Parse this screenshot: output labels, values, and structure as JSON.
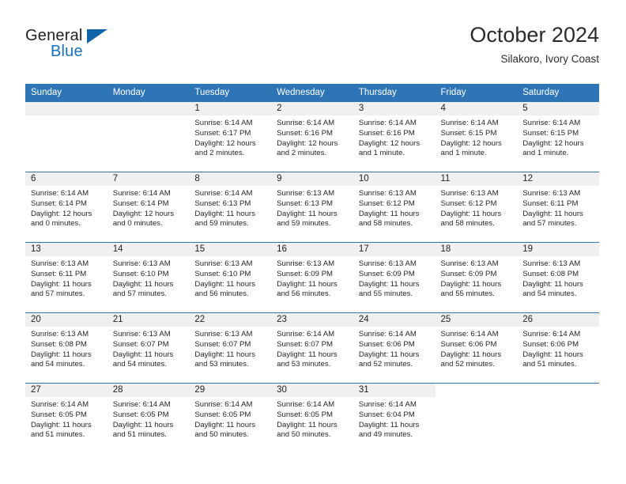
{
  "brand": {
    "word_top": "General",
    "word_bottom": "Blue",
    "triangle_color": "#1264a8",
    "blue_color": "#1673bb"
  },
  "header": {
    "title": "October 2024",
    "subtitle": "Silakoro, Ivory Coast"
  },
  "theme": {
    "header_bg": "#2e75b6",
    "daynum_bg": "#f0f0f0",
    "grid_line": "#2e75b6"
  },
  "calendar": {
    "weekday_headers": [
      "Sunday",
      "Monday",
      "Tuesday",
      "Wednesday",
      "Thursday",
      "Friday",
      "Saturday"
    ],
    "weeks": [
      [
        {
          "day": "",
          "blank": true
        },
        {
          "day": "",
          "blank": true
        },
        {
          "day": "1",
          "sunrise": "Sunrise: 6:14 AM",
          "sunset": "Sunset: 6:17 PM",
          "daylight": "Daylight: 12 hours and 2 minutes."
        },
        {
          "day": "2",
          "sunrise": "Sunrise: 6:14 AM",
          "sunset": "Sunset: 6:16 PM",
          "daylight": "Daylight: 12 hours and 2 minutes."
        },
        {
          "day": "3",
          "sunrise": "Sunrise: 6:14 AM",
          "sunset": "Sunset: 6:16 PM",
          "daylight": "Daylight: 12 hours and 1 minute."
        },
        {
          "day": "4",
          "sunrise": "Sunrise: 6:14 AM",
          "sunset": "Sunset: 6:15 PM",
          "daylight": "Daylight: 12 hours and 1 minute."
        },
        {
          "day": "5",
          "sunrise": "Sunrise: 6:14 AM",
          "sunset": "Sunset: 6:15 PM",
          "daylight": "Daylight: 12 hours and 1 minute."
        }
      ],
      [
        {
          "day": "6",
          "sunrise": "Sunrise: 6:14 AM",
          "sunset": "Sunset: 6:14 PM",
          "daylight": "Daylight: 12 hours and 0 minutes."
        },
        {
          "day": "7",
          "sunrise": "Sunrise: 6:14 AM",
          "sunset": "Sunset: 6:14 PM",
          "daylight": "Daylight: 12 hours and 0 minutes."
        },
        {
          "day": "8",
          "sunrise": "Sunrise: 6:14 AM",
          "sunset": "Sunset: 6:13 PM",
          "daylight": "Daylight: 11 hours and 59 minutes."
        },
        {
          "day": "9",
          "sunrise": "Sunrise: 6:13 AM",
          "sunset": "Sunset: 6:13 PM",
          "daylight": "Daylight: 11 hours and 59 minutes."
        },
        {
          "day": "10",
          "sunrise": "Sunrise: 6:13 AM",
          "sunset": "Sunset: 6:12 PM",
          "daylight": "Daylight: 11 hours and 58 minutes."
        },
        {
          "day": "11",
          "sunrise": "Sunrise: 6:13 AM",
          "sunset": "Sunset: 6:12 PM",
          "daylight": "Daylight: 11 hours and 58 minutes."
        },
        {
          "day": "12",
          "sunrise": "Sunrise: 6:13 AM",
          "sunset": "Sunset: 6:11 PM",
          "daylight": "Daylight: 11 hours and 57 minutes."
        }
      ],
      [
        {
          "day": "13",
          "sunrise": "Sunrise: 6:13 AM",
          "sunset": "Sunset: 6:11 PM",
          "daylight": "Daylight: 11 hours and 57 minutes."
        },
        {
          "day": "14",
          "sunrise": "Sunrise: 6:13 AM",
          "sunset": "Sunset: 6:10 PM",
          "daylight": "Daylight: 11 hours and 57 minutes."
        },
        {
          "day": "15",
          "sunrise": "Sunrise: 6:13 AM",
          "sunset": "Sunset: 6:10 PM",
          "daylight": "Daylight: 11 hours and 56 minutes."
        },
        {
          "day": "16",
          "sunrise": "Sunrise: 6:13 AM",
          "sunset": "Sunset: 6:09 PM",
          "daylight": "Daylight: 11 hours and 56 minutes."
        },
        {
          "day": "17",
          "sunrise": "Sunrise: 6:13 AM",
          "sunset": "Sunset: 6:09 PM",
          "daylight": "Daylight: 11 hours and 55 minutes."
        },
        {
          "day": "18",
          "sunrise": "Sunrise: 6:13 AM",
          "sunset": "Sunset: 6:09 PM",
          "daylight": "Daylight: 11 hours and 55 minutes."
        },
        {
          "day": "19",
          "sunrise": "Sunrise: 6:13 AM",
          "sunset": "Sunset: 6:08 PM",
          "daylight": "Daylight: 11 hours and 54 minutes."
        }
      ],
      [
        {
          "day": "20",
          "sunrise": "Sunrise: 6:13 AM",
          "sunset": "Sunset: 6:08 PM",
          "daylight": "Daylight: 11 hours and 54 minutes."
        },
        {
          "day": "21",
          "sunrise": "Sunrise: 6:13 AM",
          "sunset": "Sunset: 6:07 PM",
          "daylight": "Daylight: 11 hours and 54 minutes."
        },
        {
          "day": "22",
          "sunrise": "Sunrise: 6:13 AM",
          "sunset": "Sunset: 6:07 PM",
          "daylight": "Daylight: 11 hours and 53 minutes."
        },
        {
          "day": "23",
          "sunrise": "Sunrise: 6:14 AM",
          "sunset": "Sunset: 6:07 PM",
          "daylight": "Daylight: 11 hours and 53 minutes."
        },
        {
          "day": "24",
          "sunrise": "Sunrise: 6:14 AM",
          "sunset": "Sunset: 6:06 PM",
          "daylight": "Daylight: 11 hours and 52 minutes."
        },
        {
          "day": "25",
          "sunrise": "Sunrise: 6:14 AM",
          "sunset": "Sunset: 6:06 PM",
          "daylight": "Daylight: 11 hours and 52 minutes."
        },
        {
          "day": "26",
          "sunrise": "Sunrise: 6:14 AM",
          "sunset": "Sunset: 6:06 PM",
          "daylight": "Daylight: 11 hours and 51 minutes."
        }
      ],
      [
        {
          "day": "27",
          "sunrise": "Sunrise: 6:14 AM",
          "sunset": "Sunset: 6:05 PM",
          "daylight": "Daylight: 11 hours and 51 minutes."
        },
        {
          "day": "28",
          "sunrise": "Sunrise: 6:14 AM",
          "sunset": "Sunset: 6:05 PM",
          "daylight": "Daylight: 11 hours and 51 minutes."
        },
        {
          "day": "29",
          "sunrise": "Sunrise: 6:14 AM",
          "sunset": "Sunset: 6:05 PM",
          "daylight": "Daylight: 11 hours and 50 minutes."
        },
        {
          "day": "30",
          "sunrise": "Sunrise: 6:14 AM",
          "sunset": "Sunset: 6:05 PM",
          "daylight": "Daylight: 11 hours and 50 minutes."
        },
        {
          "day": "31",
          "sunrise": "Sunrise: 6:14 AM",
          "sunset": "Sunset: 6:04 PM",
          "daylight": "Daylight: 11 hours and 49 minutes."
        },
        {
          "day": "",
          "outside": true
        },
        {
          "day": "",
          "outside": true
        }
      ]
    ]
  }
}
